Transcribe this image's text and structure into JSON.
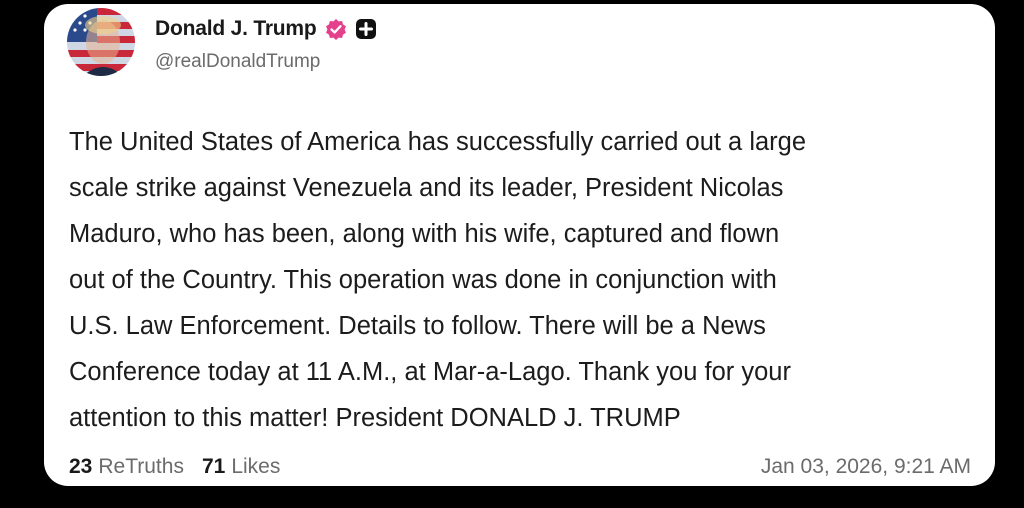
{
  "post": {
    "author": {
      "display_name": "Donald J. Trump",
      "handle": "@realDonaldTrump",
      "avatar_icon": "profile-avatar-flag-portrait",
      "badges": [
        "verified-badge-icon",
        "affiliate-badge-icon"
      ]
    },
    "body": "The United States of America has successfully carried out a large\nscale strike against Venezuela and its leader, President Nicolas\nMaduro, who has been, along with his wife, captured and flown\nout of the Country. This operation was done in conjunction with\nU.S. Law Enforcement. Details to follow. There will be a News\nConference today at 11 A.M., at Mar-a-Lago. Thank you for your\nattention to this matter! President DONALD J. TRUMP",
    "stats": {
      "retruths_count": "23",
      "retruths_label": "ReTruths",
      "likes_count": "71",
      "likes_label": "Likes"
    },
    "timestamp": "Jan 03, 2026, 9:21 AM"
  },
  "colors": {
    "background": "#000000",
    "card": "#ffffff",
    "verified_badge": "#e4408c",
    "text_primary": "#1c1c1c",
    "text_secondary": "#6b6b6b"
  }
}
